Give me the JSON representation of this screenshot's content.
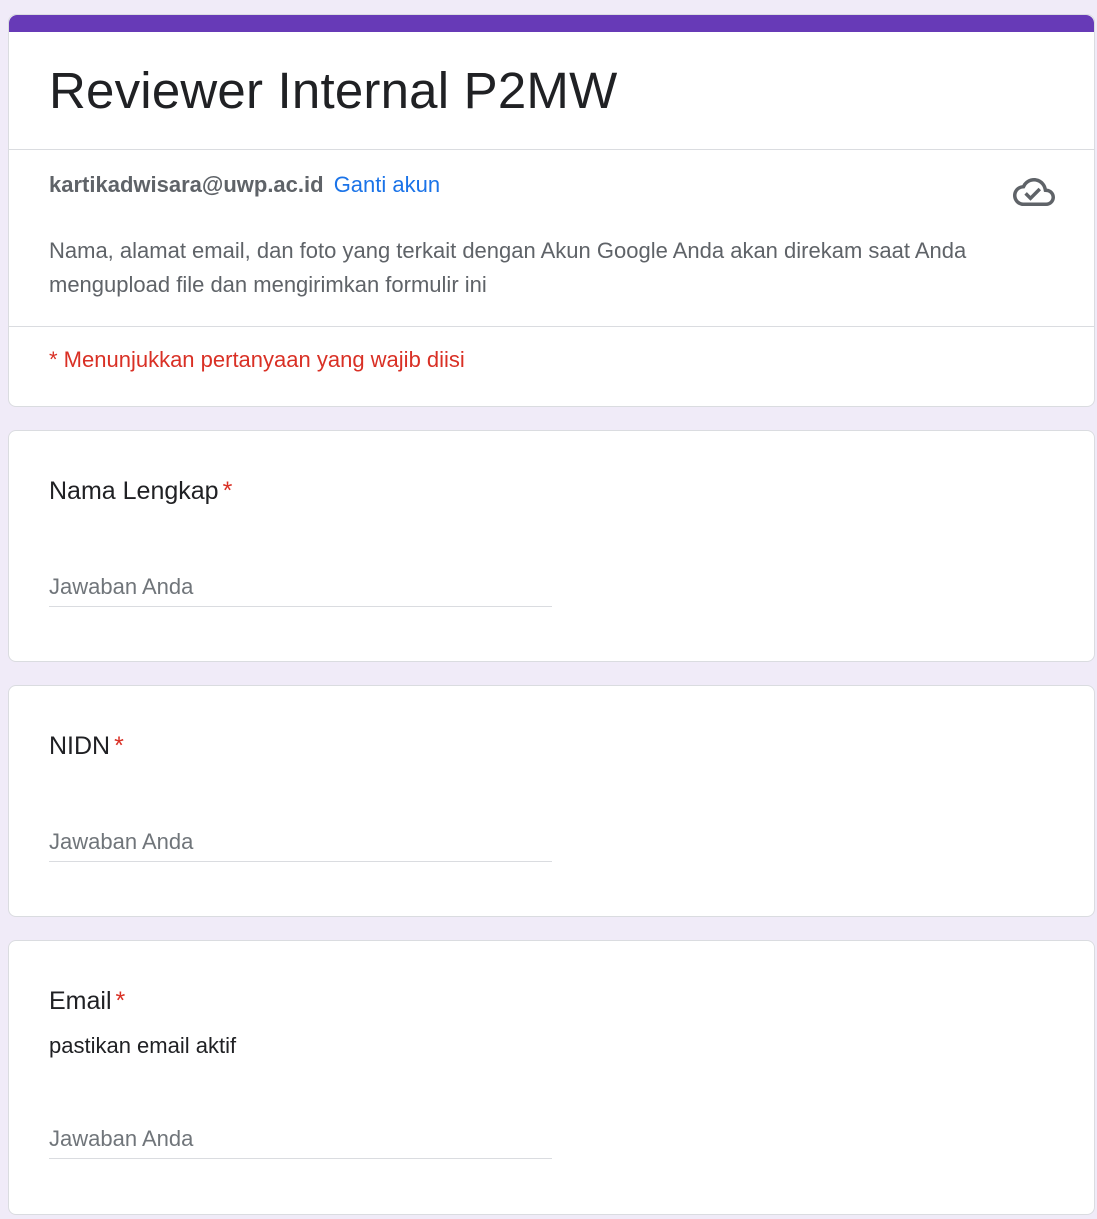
{
  "form": {
    "title": "Reviewer Internal P2MW",
    "accent_color": "#673ab7",
    "account": {
      "email": "kartikadwisara@uwp.ac.id",
      "switch_label": "Ganti akun",
      "status_icon": "cloud-check-icon"
    },
    "notice": "Nama, alamat email, dan foto yang terkait dengan Akun Google Anda akan direkam saat Anda mengupload file dan mengirimkan formulir ini",
    "required_legend": "* Menunjukkan pertanyaan yang wajib diisi"
  },
  "questions": [
    {
      "title": "Nama Lengkap",
      "required_mark": "*",
      "placeholder": "Jawaban Anda"
    },
    {
      "title": "NIDN",
      "required_mark": "*",
      "placeholder": "Jawaban Anda"
    },
    {
      "title": "Email",
      "required_mark": "*",
      "description": "pastikan email aktif",
      "placeholder": "Jawaban Anda"
    }
  ]
}
